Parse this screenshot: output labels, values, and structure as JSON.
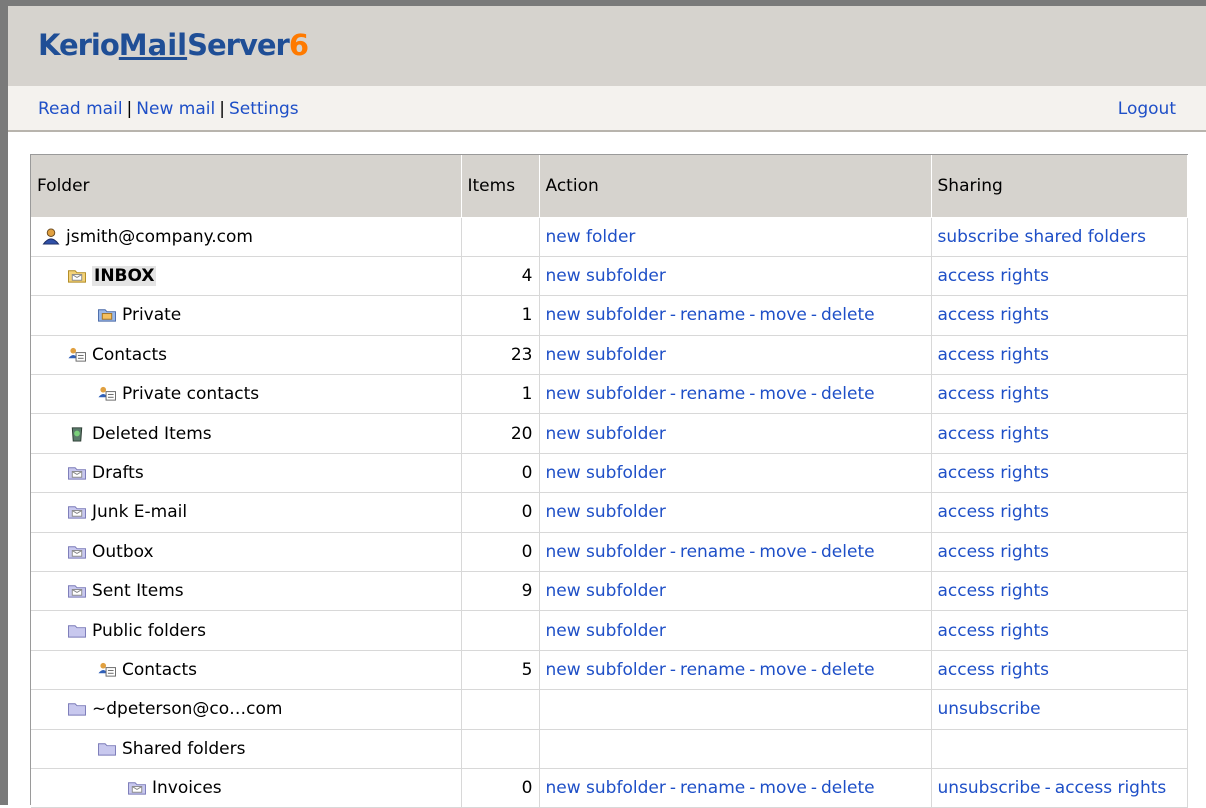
{
  "header": {
    "logo_prefix": "Kerio",
    "logo_mail": "Mail",
    "logo_suffix": "Server",
    "logo_version": "6"
  },
  "nav": {
    "read_mail": "Read mail",
    "new_mail": "New mail",
    "settings": "Settings",
    "separator": "|",
    "logout": "Logout"
  },
  "table": {
    "headers": {
      "folder": "Folder",
      "items": "Items",
      "action": "Action",
      "sharing": "Sharing"
    },
    "actions": {
      "new_folder": "new folder",
      "new_subfolder": "new subfolder",
      "rename": "rename",
      "move": "move",
      "delete": "delete",
      "dash": "-"
    },
    "sharing": {
      "subscribe_shared": "subscribe shared folders",
      "access_rights": "access rights",
      "unsubscribe": "unsubscribe"
    },
    "rows": [
      {
        "name": "jsmith@company.com",
        "items": "",
        "icon": "user-icon"
      },
      {
        "name": "INBOX",
        "items": "4",
        "icon": "inbox-folder-icon"
      },
      {
        "name": "Private",
        "items": "1",
        "icon": "mail-folder-icon"
      },
      {
        "name": "Contacts",
        "items": "23",
        "icon": "contacts-icon"
      },
      {
        "name": "Private contacts",
        "items": "1",
        "icon": "contacts-icon"
      },
      {
        "name": "Deleted Items",
        "items": "20",
        "icon": "trash-icon"
      },
      {
        "name": "Drafts",
        "items": "0",
        "icon": "mail-folder-icon"
      },
      {
        "name": "Junk E-mail",
        "items": "0",
        "icon": "mail-folder-icon"
      },
      {
        "name": "Outbox",
        "items": "0",
        "icon": "mail-folder-icon"
      },
      {
        "name": "Sent Items",
        "items": "9",
        "icon": "mail-folder-icon"
      },
      {
        "name": "Public folders",
        "items": "",
        "icon": "folder-icon"
      },
      {
        "name": "Contacts",
        "items": "5",
        "icon": "contacts-icon"
      },
      {
        "name": "~dpeterson@co…com",
        "items": "",
        "icon": "folder-icon"
      },
      {
        "name": "Shared folders",
        "items": "",
        "icon": "folder-icon"
      },
      {
        "name": "Invoices",
        "items": "0",
        "icon": "mail-folder-icon"
      }
    ]
  }
}
